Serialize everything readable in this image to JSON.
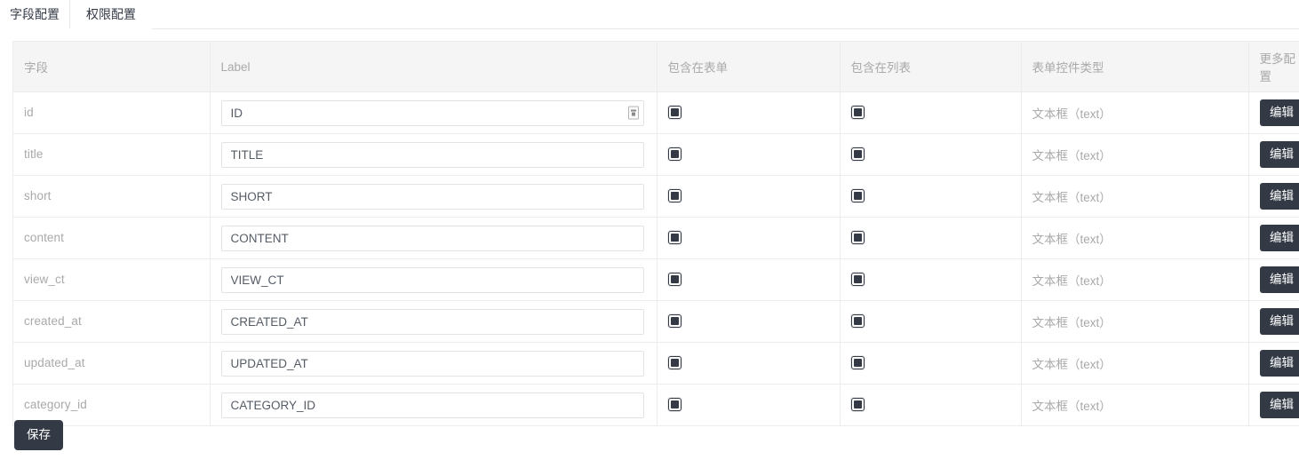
{
  "tabs": [
    {
      "label": "字段配置",
      "active": true,
      "name": "tab-field-config"
    },
    {
      "label": "权限配置",
      "active": false,
      "name": "tab-permission-config"
    }
  ],
  "table": {
    "headers": {
      "field": "字段",
      "label": "Label",
      "in_form": "包含在表单",
      "in_list": "包含在列表",
      "widget_type": "表单控件类型",
      "more": "更多配置"
    },
    "edit_label": "编辑",
    "rows": [
      {
        "field": "id",
        "label_value": "ID",
        "in_form": true,
        "in_list": true,
        "widget_type": "文本框（text）",
        "has_resize_handle": true
      },
      {
        "field": "title",
        "label_value": "TITLE",
        "in_form": true,
        "in_list": true,
        "widget_type": "文本框（text）",
        "has_resize_handle": false
      },
      {
        "field": "short",
        "label_value": "SHORT",
        "in_form": true,
        "in_list": true,
        "widget_type": "文本框（text）",
        "has_resize_handle": false
      },
      {
        "field": "content",
        "label_value": "CONTENT",
        "in_form": true,
        "in_list": true,
        "widget_type": "文本框（text）",
        "has_resize_handle": false
      },
      {
        "field": "view_ct",
        "label_value": "VIEW_CT",
        "in_form": true,
        "in_list": true,
        "widget_type": "文本框（text）",
        "has_resize_handle": false
      },
      {
        "field": "created_at",
        "label_value": "CREATED_AT",
        "in_form": true,
        "in_list": true,
        "widget_type": "文本框（text）",
        "has_resize_handle": false
      },
      {
        "field": "updated_at",
        "label_value": "UPDATED_AT",
        "in_form": true,
        "in_list": true,
        "widget_type": "文本框（text）",
        "has_resize_handle": false
      },
      {
        "field": "category_id",
        "label_value": "CATEGORY_ID",
        "in_form": true,
        "in_list": true,
        "widget_type": "文本框（text）",
        "has_resize_handle": false
      }
    ]
  },
  "footer": {
    "save_label": "保存"
  },
  "colors": {
    "dark": "#333a45",
    "muted_text": "#a9a9a9",
    "border": "#ececec",
    "header_bg": "#f5f5f5",
    "input_text": "#555c66"
  }
}
